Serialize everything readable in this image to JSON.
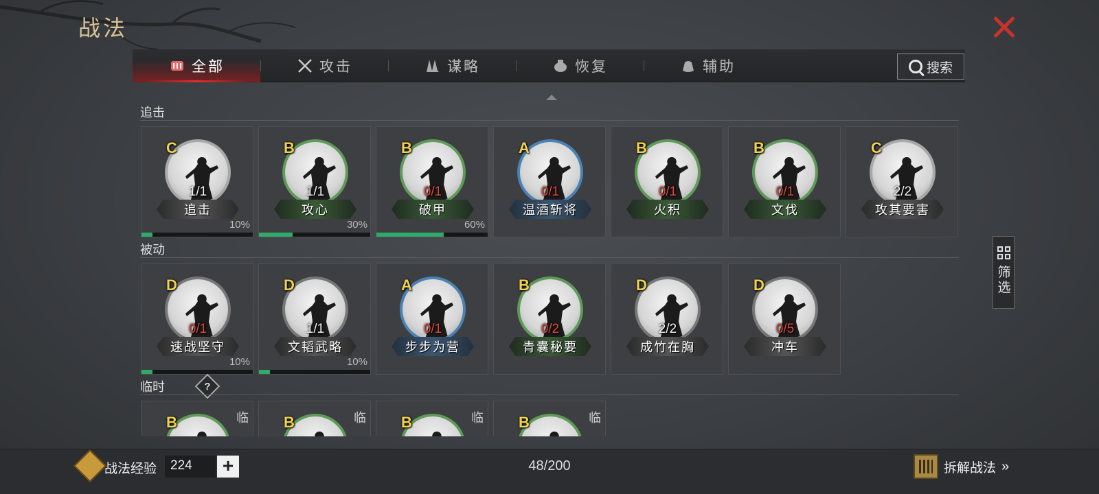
{
  "title": "战法",
  "tabs": [
    {
      "label": "全部",
      "icon": "scroll-icon",
      "active": true
    },
    {
      "label": "攻击",
      "icon": "crossed-swords-icon",
      "active": false
    },
    {
      "label": "谋略",
      "icon": "feather-fan-icon",
      "active": false
    },
    {
      "label": "恢复",
      "icon": "medicine-pot-icon",
      "active": false
    },
    {
      "label": "辅助",
      "icon": "pouch-icon",
      "active": false
    }
  ],
  "search_label": "搜索",
  "filter_label": "筛选",
  "sections": {
    "pursuit": {
      "label": "追击",
      "cards": [
        {
          "grade": "C",
          "count": "1/1",
          "name": "追击",
          "percent": "10%",
          "progress": 0.1
        },
        {
          "grade": "B",
          "count": "1/1",
          "name": "攻心",
          "percent": "30%",
          "progress": 0.3
        },
        {
          "grade": "B",
          "count": "0/1",
          "name": "破甲",
          "percent": "60%",
          "progress": 0.6
        },
        {
          "grade": "A",
          "count": "0/1",
          "name": "温酒斩将",
          "percent": "",
          "progress": null
        },
        {
          "grade": "B",
          "count": "0/1",
          "name": "火积",
          "percent": "",
          "progress": null
        },
        {
          "grade": "B",
          "count": "0/1",
          "name": "文伐",
          "percent": "",
          "progress": null
        },
        {
          "grade": "C",
          "count": "2/2",
          "name": "攻其要害",
          "percent": "",
          "progress": null
        }
      ]
    },
    "passive": {
      "label": "被动",
      "cards": [
        {
          "grade": "D",
          "count": "0/1",
          "name": "速战坚守",
          "percent": "10%",
          "progress": 0.1
        },
        {
          "grade": "D",
          "count": "1/1",
          "name": "文韬武略",
          "percent": "10%",
          "progress": 0.1
        },
        {
          "grade": "A",
          "count": "0/1",
          "name": "步步为营",
          "percent": "",
          "progress": null
        },
        {
          "grade": "B",
          "count": "0/2",
          "name": "青囊秘要",
          "percent": "",
          "progress": null
        },
        {
          "grade": "D",
          "count": "2/2",
          "name": "成竹在胸",
          "percent": "",
          "progress": null
        },
        {
          "grade": "D",
          "count": "0/5",
          "name": "冲车",
          "percent": "",
          "progress": null
        }
      ]
    },
    "temporary": {
      "label": "临时",
      "help": "?",
      "cards": [
        {
          "grade": "B",
          "tag": "临"
        },
        {
          "grade": "B",
          "tag": "临"
        },
        {
          "grade": "B",
          "tag": "临"
        },
        {
          "grade": "B",
          "tag": "临"
        }
      ]
    }
  },
  "footer": {
    "exp_label": "战法经验",
    "exp_value": "224",
    "plus": "+",
    "capacity": "48/200",
    "disassemble_label": "拆解战法",
    "disassemble_arrow": "»"
  }
}
